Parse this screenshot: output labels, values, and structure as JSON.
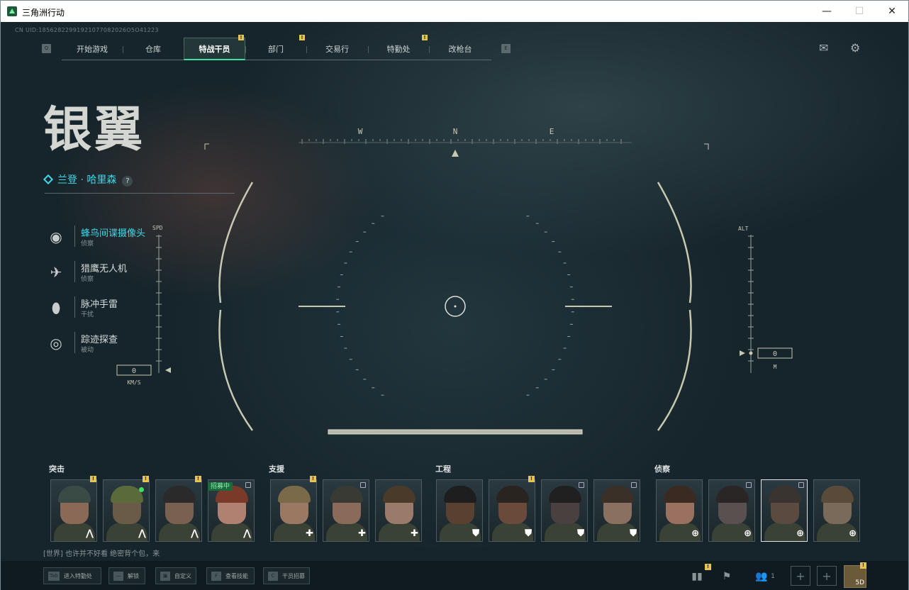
{
  "window": {
    "title": "三角洲行动",
    "min": "—",
    "max": "☐",
    "close": "✕"
  },
  "uid": "CN UID:18562822991921077082026O5O41223",
  "nav": {
    "left_key": "Q",
    "right_key": "E",
    "tabs": [
      {
        "label": "开始游戏",
        "active": false
      },
      {
        "label": "仓库",
        "active": false
      },
      {
        "label": "特战干员",
        "active": true,
        "badge": "!"
      },
      {
        "label": "部门",
        "active": false,
        "badge": "!"
      },
      {
        "label": "交易行",
        "active": false
      },
      {
        "label": "特勤处",
        "active": false,
        "badge": "!"
      },
      {
        "label": "改枪台",
        "active": false
      }
    ]
  },
  "top_icons": [
    "mail-icon",
    "gear-icon"
  ],
  "operator": {
    "codename": "银翼",
    "realname": "兰登 · 哈里森",
    "help": "?"
  },
  "abilities": [
    {
      "name": "蜂鸟间谍摄像头",
      "type": "侦察",
      "icon": "camera-icon",
      "selected": true
    },
    {
      "name": "猎鹰无人机",
      "type": "侦察",
      "icon": "drone-icon"
    },
    {
      "name": "脉冲手雷",
      "type": "干扰",
      "icon": "grenade-icon"
    },
    {
      "name": "踪迹探查",
      "type": "被动",
      "icon": "eye-icon"
    }
  ],
  "hud": {
    "compass": [
      "W",
      "N",
      "E"
    ],
    "spd_label": "SPD",
    "spd_value": "0",
    "spd_unit": "KM/S",
    "alt_label": "ALT",
    "alt_value": "0",
    "alt_unit": "M"
  },
  "classes": [
    {
      "name": "突击",
      "role_glyph": "⋀",
      "cards": [
        {
          "badge": "!"
        },
        {
          "badge": "!",
          "online": true
        },
        {
          "badge": "!"
        },
        {
          "recruit": "招募中",
          "locked": true
        }
      ]
    },
    {
      "name": "支援",
      "role_glyph": "✚",
      "cards": [
        {
          "badge": "!"
        },
        {
          "locked": true
        },
        {}
      ]
    },
    {
      "name": "工程",
      "role_glyph": "⛊",
      "cards": [
        {},
        {
          "badge": "!"
        },
        {
          "locked": true
        },
        {
          "locked": true
        }
      ]
    },
    {
      "name": "侦察",
      "role_glyph": "⊕",
      "cards": [
        {},
        {
          "locked": true
        },
        {
          "locked": true,
          "selected": true
        },
        {}
      ]
    }
  ],
  "chat": "[世界] 也许并不好看  绝密背个包，来",
  "bottom_hints": [
    {
      "key": "Tab",
      "label": "进入特勤处"
    },
    {
      "key": "—",
      "label": "解锁"
    },
    {
      "key": "▣",
      "label": "自定义"
    },
    {
      "key": "F",
      "label": "查看技能"
    },
    {
      "key": "C",
      "label": "干员招募"
    }
  ],
  "bottom_right": {
    "party_count": "1",
    "level": "5D"
  }
}
